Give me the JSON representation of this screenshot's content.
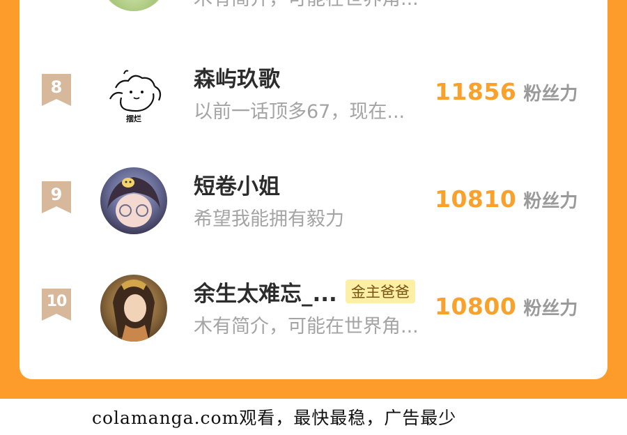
{
  "leaderboard": {
    "top_partial": {
      "bio": "木有简介，可能在世界角..."
    },
    "rows": [
      {
        "rank": "8",
        "name": "森屿玖歌",
        "tag": "",
        "bio": "以前一话顶多67，现在...",
        "score": "11856",
        "score_unit": "粉丝力",
        "avatar_caption": "摆烂"
      },
      {
        "rank": "9",
        "name": "短卷小姐",
        "tag": "",
        "bio": "希望我能拥有毅力",
        "score": "10810",
        "score_unit": "粉丝力",
        "avatar_caption": ""
      },
      {
        "rank": "10",
        "name": "余生太难忘_...",
        "tag": "金主爸爸",
        "bio": "木有简介，可能在世界角...",
        "score": "10800",
        "score_unit": "粉丝力",
        "avatar_caption": ""
      }
    ]
  },
  "footer": {
    "text": "colamanga.com观看，最快最稳，广告最少"
  },
  "colors": {
    "background_orange": "#fd9b2b",
    "score_orange": "#f9a12a",
    "badge_tan": "#d7b89a",
    "tag_bg": "#fdf0a6"
  }
}
